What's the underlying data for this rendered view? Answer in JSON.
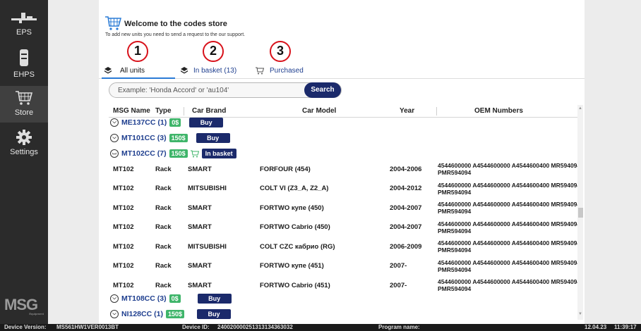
{
  "sidebar": {
    "items": [
      {
        "label": "EPS",
        "icon": "eps-icon"
      },
      {
        "label": "EHPS",
        "icon": "ehps-icon"
      },
      {
        "label": "Store",
        "icon": "store-cart-icon",
        "active": true
      },
      {
        "label": "Settings",
        "icon": "gear-icon"
      }
    ],
    "logo_text": "MSG",
    "logo_sub": "Equipment"
  },
  "header": {
    "title": "Welcome to the codes store",
    "subtitle": "To add new units you need to send a request to the our support."
  },
  "callouts": [
    "1",
    "2",
    "3"
  ],
  "tabs": [
    {
      "label": "All units",
      "active": true
    },
    {
      "label": "In basket (13)"
    },
    {
      "label": "Purchased"
    }
  ],
  "search": {
    "placeholder": "Example: 'Honda Accord' or 'au104'",
    "button_label": "Search"
  },
  "table": {
    "columns": [
      "MSG Name",
      "Type",
      "Car Brand",
      "Car Model",
      "Year",
      "OEM Numbers"
    ],
    "groups_top": [
      {
        "name": "ME137CC (1)",
        "price": "0$",
        "action": "Buy"
      },
      {
        "name": "MT101CC (3)",
        "price": "150$",
        "action": "Buy"
      },
      {
        "name": "MT102CC (7)",
        "price": "150$",
        "action": "In basket",
        "expanded": true
      }
    ],
    "rows": [
      {
        "name": "MT102",
        "type": "Rack",
        "brand": "SMART",
        "model": "FORFOUR (454)",
        "year": "2004-2006",
        "oem": "4544600000 A4544600000 A4544600400 MR594094 PMR594094"
      },
      {
        "name": "MT102",
        "type": "Rack",
        "brand": "MITSUBISHI",
        "model": "COLT VI (Z3_A, Z2_A)",
        "year": "2004-2012",
        "oem": "4544600000 A4544600000 A4544600400 MR594094 PMR594094"
      },
      {
        "name": "MT102",
        "type": "Rack",
        "brand": "SMART",
        "model": "FORTWO купе (450)",
        "year": "2004-2007",
        "oem": "4544600000 A4544600000 A4544600400 MR594094 PMR594094"
      },
      {
        "name": "MT102",
        "type": "Rack",
        "brand": "SMART",
        "model": "FORTWO Cabrio (450)",
        "year": "2004-2007",
        "oem": "4544600000 A4544600000 A4544600400 MR594094 PMR594094"
      },
      {
        "name": "MT102",
        "type": "Rack",
        "brand": "MITSUBISHI",
        "model": "COLT CZC кабрио (RG)",
        "year": "2006-2009",
        "oem": "4544600000 A4544600000 A4544600400 MR594094 PMR594094"
      },
      {
        "name": "MT102",
        "type": "Rack",
        "brand": "SMART",
        "model": "FORTWO купе (451)",
        "year": "2007-",
        "oem": "4544600000 A4544600000 A4544600400 MR594094 PMR594094"
      },
      {
        "name": "MT102",
        "type": "Rack",
        "brand": "SMART",
        "model": "FORTWO Cabrio (451)",
        "year": "2007-",
        "oem": "4544600000 A4544600000 A4544600400 MR594094 PMR594094"
      }
    ],
    "groups_bottom": [
      {
        "name": "MT108CC (3)",
        "price": "0$",
        "action": "Buy"
      },
      {
        "name": "NI128CC (1)",
        "price": "150$",
        "action": "Buy"
      }
    ]
  },
  "statusbar": {
    "device_version_label": "Device Version:",
    "device_version": "MS561HW1VER0013BT",
    "device_id_label": "Device ID:",
    "device_id": "240020000251313134363032",
    "program_name_label": "Program name:",
    "date": "12.04.23",
    "time": "11:39:17"
  },
  "colors": {
    "accent_navy": "#1b2a6b",
    "price_green": "#3fb56a",
    "callout_red": "#d8111a",
    "sidebar_bg": "#2b2b2b",
    "link_blue": "#1f3f8f"
  }
}
